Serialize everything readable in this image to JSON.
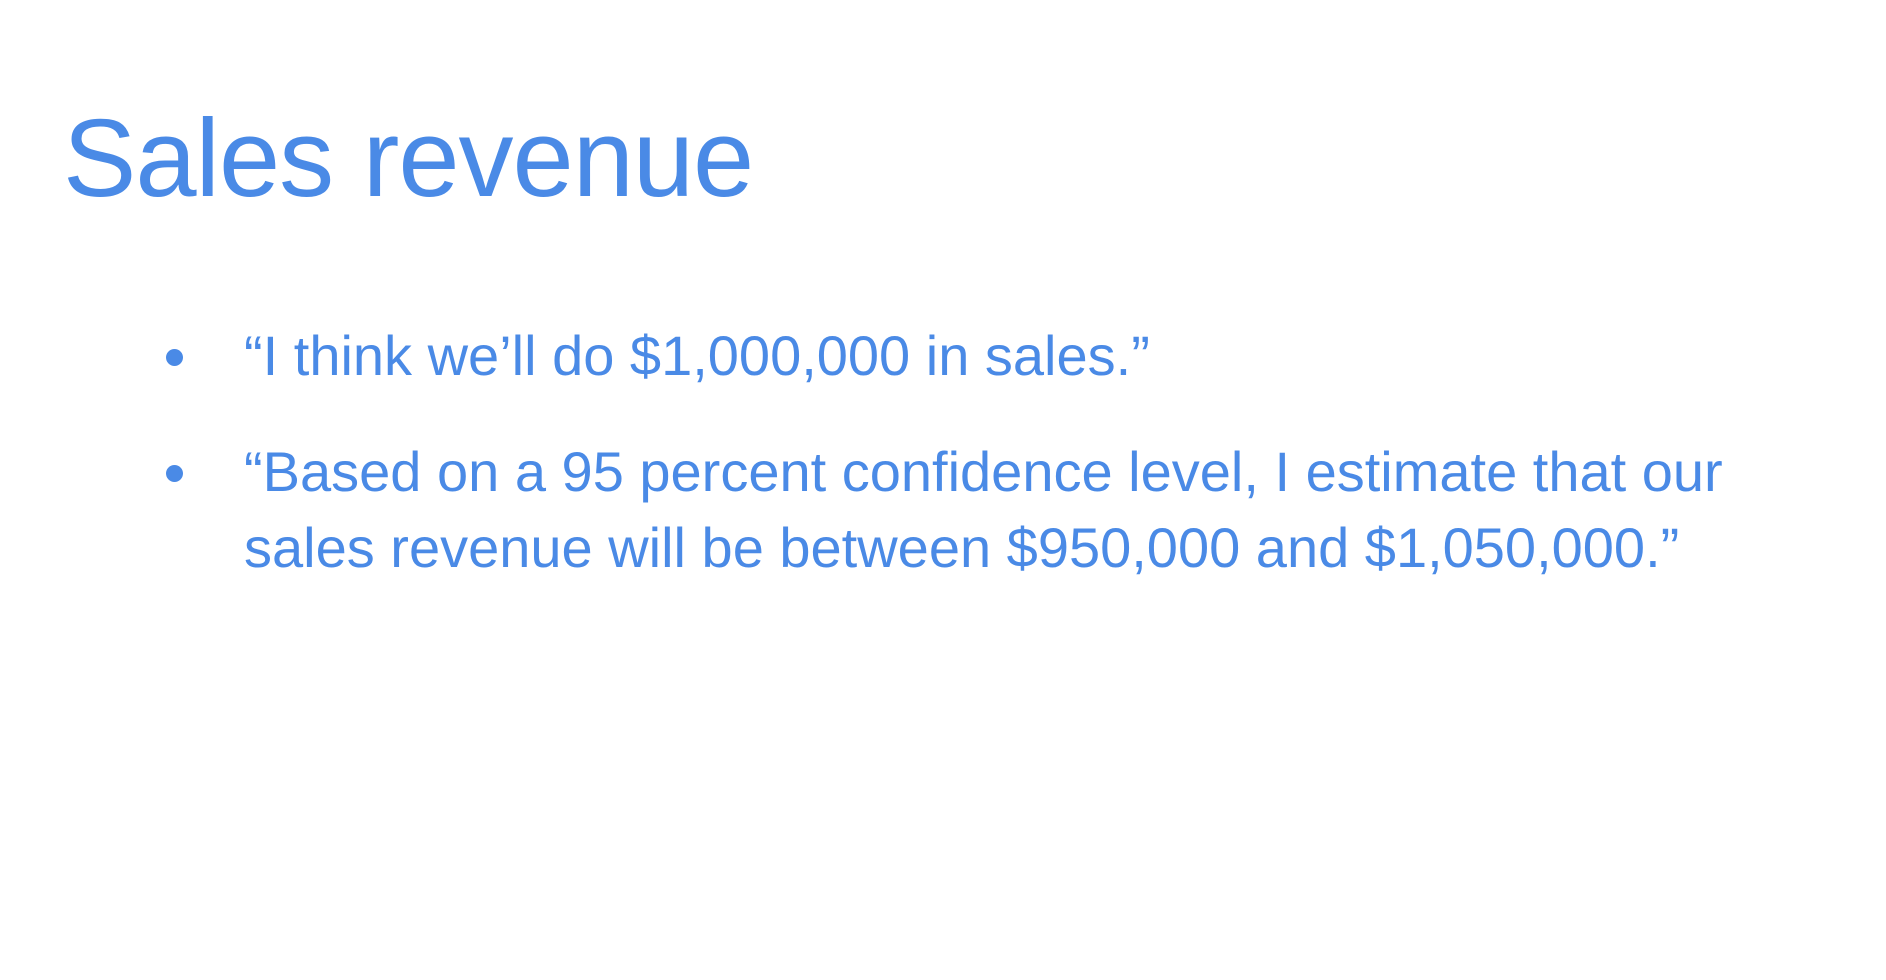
{
  "slide": {
    "title": "Sales revenue",
    "bullets": [
      {
        "text": "“I think we’ll do $1,000,000 in sales.”"
      },
      {
        "text": "“Based on a 95 percent confidence level, I estimate that our sales revenue will be between $950,000 and $1,050,000.”"
      }
    ]
  },
  "colors": {
    "accent": "#4a8ae6",
    "background": "#ffffff"
  }
}
